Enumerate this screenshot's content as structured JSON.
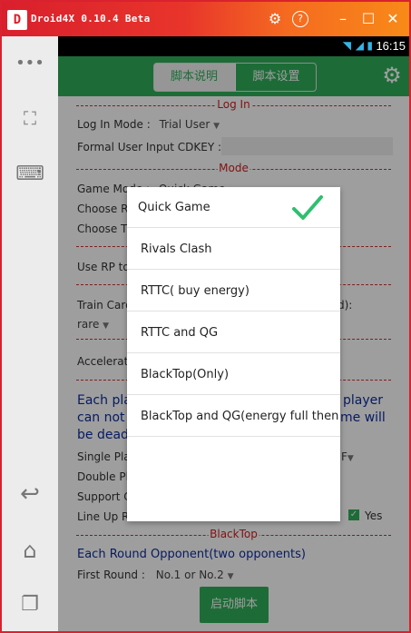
{
  "window": {
    "title": "Droid4X 0.10.4 Beta",
    "logo": "D"
  },
  "status_bar": {
    "time": "16:15"
  },
  "tabs": {
    "left": "脚本说明",
    "right": "脚本设置"
  },
  "sections": {
    "login": "Log In",
    "mode": "Mode",
    "blacktop": "BlackTop"
  },
  "login": {
    "mode_label": "Log In Mode :",
    "mode_value": "Trial User",
    "cdkey_label": "Formal User Input CDKEY :"
  },
  "mode": {
    "game_mode_label": "Game Mode :",
    "game_mode_value": "Quick Game",
    "choose_r_label": "Choose R",
    "choose_t_label": "Choose T",
    "use_rp_label": "Use RP to",
    "train_label": "Train Card",
    "train_suffix": "d):",
    "rare_value": "rare",
    "accel_label": "Accelerat"
  },
  "warning_text": {
    "line1_left": "Each pla",
    "line1_right": "player",
    "line2_left": "can not",
    "line2_right": "me will",
    "line3_left": "be dead"
  },
  "more_rows": {
    "single": "Single Pla",
    "single_suffix": "F",
    "double": "Double Pla",
    "support": "Support C",
    "lineup": "Line Up Ra",
    "yes": "Yes"
  },
  "blacktop": {
    "opponent_text": "Each Round Opponent(two opponents)",
    "first_round_label": "First Round :",
    "first_round_value": "No.1 or No.2"
  },
  "start_button": "启动脚本",
  "dialog": {
    "options": [
      {
        "label": "Quick Game",
        "selected": true
      },
      {
        "label": "Rivals Clash",
        "selected": false
      },
      {
        "label": "RTTC( buy energy)",
        "selected": false
      },
      {
        "label": "RTTC and QG",
        "selected": false
      },
      {
        "label": "BlackTop(Only)",
        "selected": false
      },
      {
        "label": "BlackTop and QG(energy full then",
        "selected": false
      }
    ]
  },
  "colors": {
    "accent": "#2fae5a",
    "titlebar": "#d91f2c",
    "section_red": "#d02020",
    "blue_text": "#0c2d9e"
  }
}
